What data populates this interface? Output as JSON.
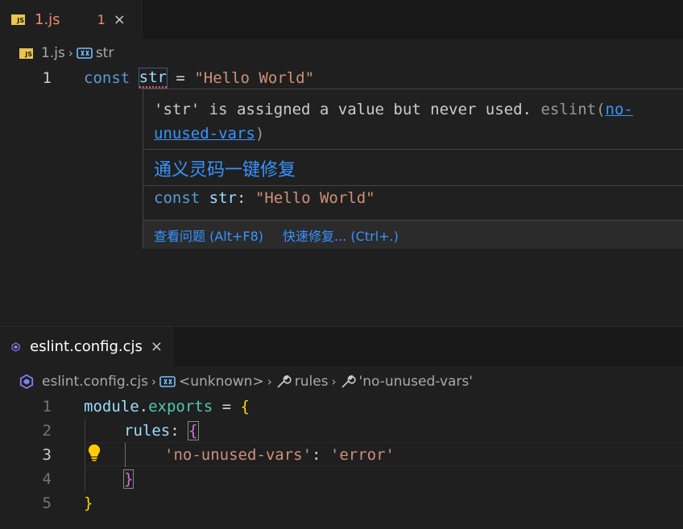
{
  "top_editor": {
    "tab": {
      "filename": "1.js",
      "problem_count": "1",
      "icon": "js-file-icon",
      "close": "×"
    },
    "breadcrumb": {
      "file": "1.js",
      "symbol": "str",
      "symbol_icon": "variable-icon"
    },
    "line_number": "1",
    "code": {
      "kw": "const",
      "name": "str",
      "eq": " = ",
      "value": "\"Hello World\""
    }
  },
  "hover": {
    "message_part1": "'str' is assigned a value but never used.",
    "source": " eslint(",
    "rule_link": "no-unused-vars",
    "source_close": ")",
    "ai_fix": "通义灵码一键修复",
    "sig_kw": "const",
    "sig_name": "str",
    "sig_colon": ": ",
    "sig_value": "\"Hello World\"",
    "action_view": "查看问题 (Alt+F8)",
    "action_fix": "快速修复... (Ctrl+.)"
  },
  "bottom_editor": {
    "tab": {
      "filename": "eslint.config.cjs",
      "icon": "eslint-hexagon-icon",
      "close": "×"
    },
    "breadcrumb": {
      "file": "eslint.config.cjs",
      "item1": "<unknown>",
      "item2": "rules",
      "item3": "'no-unused-vars'"
    },
    "lines": {
      "l1": {
        "num": "1",
        "module": "module",
        "dot": ".",
        "exports": "exports",
        "eq": " = ",
        "brace": "{"
      },
      "l2": {
        "num": "2",
        "rules": "rules",
        "colon": ": ",
        "brace": "{"
      },
      "l3": {
        "num": "3",
        "key": "'no-unused-vars'",
        "colon": ": ",
        "val": "'error'"
      },
      "l4": {
        "num": "4",
        "brace": "}"
      },
      "l5": {
        "num": "5",
        "brace": "}"
      }
    }
  },
  "colors": {
    "background": "#1f1f1f",
    "keyword": "#569cd6",
    "variable": "#9cdcfe",
    "string": "#ce9178",
    "link": "#3794ff",
    "error": "#f14c4c",
    "bracket_gold": "#ffd700",
    "bracket_purple": "#da70d6"
  }
}
